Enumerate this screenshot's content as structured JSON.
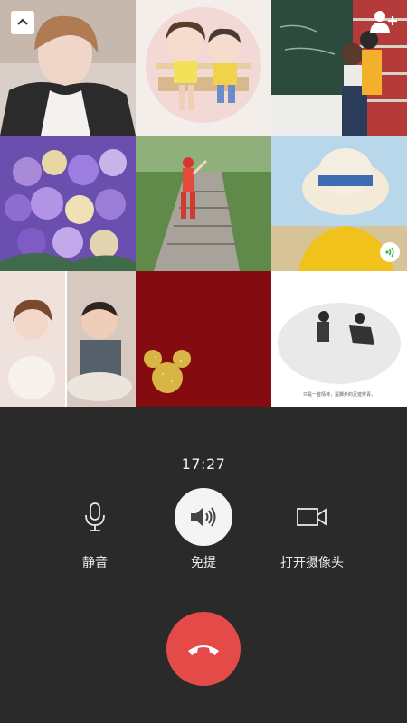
{
  "call": {
    "timer": "17:27",
    "controls": {
      "mute_label": "静音",
      "speaker_label": "免提",
      "camera_label": "打开摄像头"
    },
    "speaker_on": true
  },
  "grid": {
    "tiles": [
      {
        "name": "participant-1",
        "icon": "woman-portrait"
      },
      {
        "name": "participant-2",
        "icon": "cartoon-kids-bench"
      },
      {
        "name": "participant-3",
        "icon": "classroom-chalkboard"
      },
      {
        "name": "participant-4",
        "icon": "purple-rose-bouquet"
      },
      {
        "name": "participant-5",
        "icon": "child-garden-path"
      },
      {
        "name": "participant-6",
        "icon": "sun-hat-seaside",
        "speaking": true
      },
      {
        "name": "participant-7",
        "icon": "child-photos-collage"
      },
      {
        "name": "participant-8",
        "icon": "mickey-glitter-red"
      },
      {
        "name": "participant-9",
        "icon": "sketch-beach-people",
        "caption": "只是一首情诗，是脚步的足迹常青。"
      }
    ]
  },
  "colors": {
    "background": "#2a2a2a",
    "hangup": "#e44a48",
    "speaking_green": "#2dbb3c"
  }
}
